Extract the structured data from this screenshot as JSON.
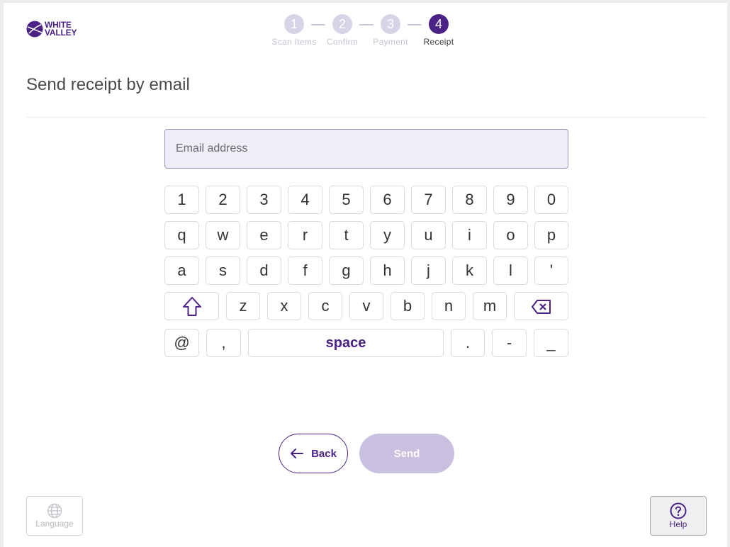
{
  "brand": {
    "line1": "WHITE",
    "line2": "VALLEY",
    "color": "#4b2386",
    "icon": "white-valley-logo-icon"
  },
  "stepper": [
    {
      "number": "1",
      "label": "Scan Items",
      "state": "inactive"
    },
    {
      "number": "2",
      "label": "Confirm",
      "state": "inactive"
    },
    {
      "number": "3",
      "label": "Payment",
      "state": "inactive"
    },
    {
      "number": "4",
      "label": "Receipt",
      "state": "active"
    }
  ],
  "page": {
    "title": "Send receipt by email"
  },
  "email_input": {
    "placeholder": "Email address",
    "value": ""
  },
  "keyboard": {
    "row1": [
      "1",
      "2",
      "3",
      "4",
      "5",
      "6",
      "7",
      "8",
      "9",
      "0"
    ],
    "row2": [
      "q",
      "w",
      "e",
      "r",
      "t",
      "y",
      "u",
      "i",
      "o",
      "p"
    ],
    "row3": [
      "a",
      "s",
      "d",
      "f",
      "g",
      "h",
      "j",
      "k",
      "l",
      "'"
    ],
    "row4": [
      "z",
      "x",
      "c",
      "v",
      "b",
      "n",
      "m"
    ],
    "row5_left": [
      "@",
      ","
    ],
    "space_label": "space",
    "row5_right": [
      ".",
      "-",
      "_"
    ],
    "shift_icon": "shift-arrow-icon",
    "backspace_icon": "backspace-icon"
  },
  "actions": {
    "back_label": "Back",
    "back_icon": "arrow-left-icon",
    "send_label": "Send",
    "send_enabled": false
  },
  "footer": {
    "language_label": "Language",
    "language_icon": "globe-icon",
    "help_label": "Help",
    "help_icon": "question-circle-icon"
  },
  "colors": {
    "accent": "#4b2386",
    "disabled": "#c9c0e0",
    "input_bg": "#f0ecfa"
  }
}
